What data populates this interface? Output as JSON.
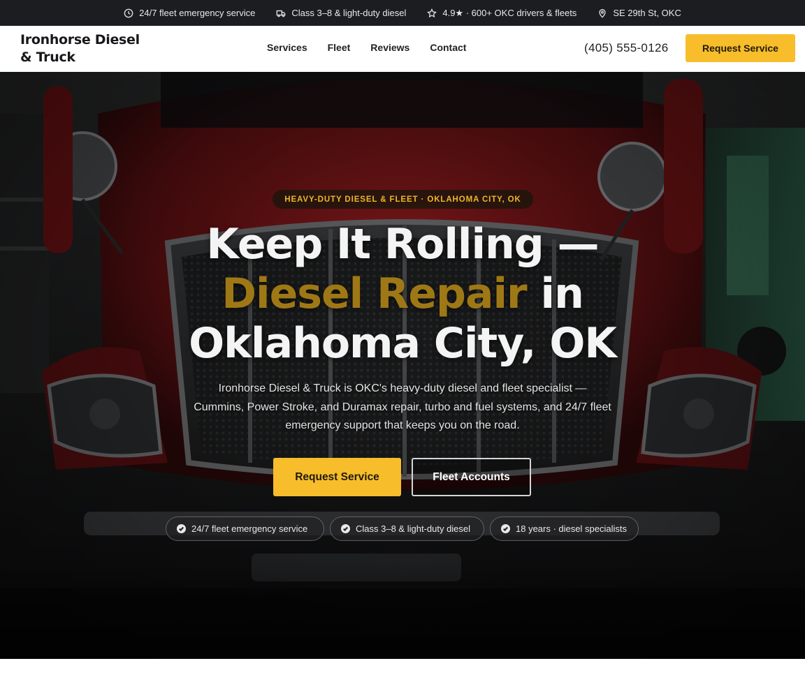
{
  "topbar": {
    "items": [
      {
        "icon": "clock-icon",
        "label": "24/7 fleet emergency service"
      },
      {
        "icon": "truck-icon",
        "label": "Class 3–8 & light-duty diesel"
      },
      {
        "icon": "star-icon",
        "label": "4.9★ · 600+ OKC drivers & fleets"
      },
      {
        "icon": "map-pin-icon",
        "label": "SE 29th St, OKC"
      }
    ]
  },
  "header": {
    "brand": "Ironhorse Diesel & Truck",
    "nav": [
      "Services",
      "Fleet",
      "Reviews",
      "Contact"
    ],
    "phone": "(405) 555-0126",
    "cta": "Request Service"
  },
  "hero": {
    "eyebrow": "HEAVY-DUTY DIESEL & FLEET · OKLAHOMA CITY, OK",
    "headline": {
      "line1": "Keep It Rolling —",
      "accent": "Diesel Repair",
      "line2_rest": " in",
      "line3": "Oklahoma City, OK"
    },
    "subcopy": "Ironhorse Diesel & Truck is OKC's heavy-duty diesel and fleet specialist — Cummins, Power Stroke, and Duramax repair, turbo and fuel systems, and 24/7 fleet emergency support that keeps you on the road.",
    "primary_cta": "Request Service",
    "secondary_cta": "Fleet Accounts",
    "chips": [
      "24/7 fleet emergency service",
      "Class 3–8 & light-duty diesel",
      "18 years · diesel specialists"
    ]
  },
  "colors": {
    "accent": "#f7bd2a",
    "headline_accent": "#9f7816",
    "topbar_bg": "#1c1d20",
    "truck_red": "#7a1416"
  }
}
